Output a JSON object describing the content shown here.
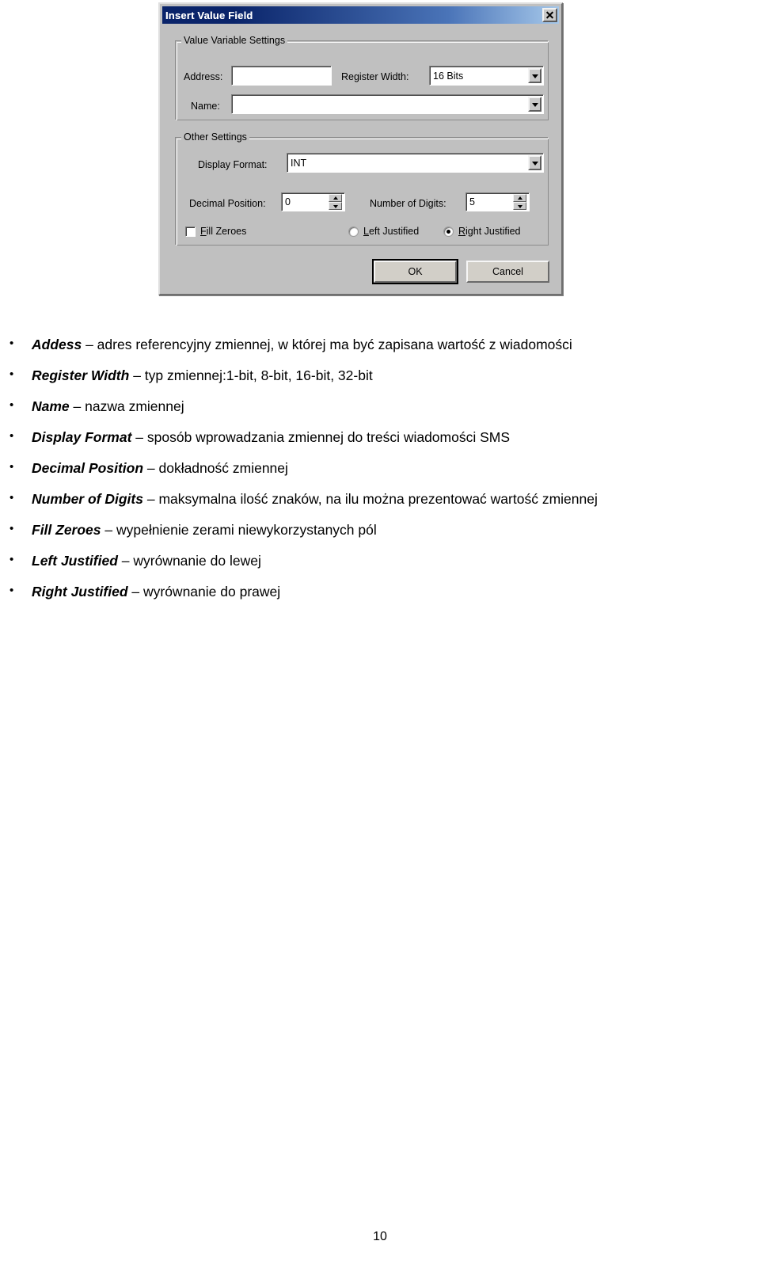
{
  "dialog": {
    "title": "Insert Value Field",
    "close_icon": "close-icon",
    "groups": {
      "value_variable": {
        "legend": "Value Variable Settings",
        "address": {
          "label": "Address:",
          "value": "",
          "placeholder": ""
        },
        "register_width": {
          "label": "Register Width:",
          "value": "16 Bits",
          "options": [
            "1 Bit",
            "8 Bits",
            "16 Bits",
            "32 Bits"
          ]
        },
        "name": {
          "label": "Name:",
          "value": "",
          "placeholder": ""
        }
      },
      "other_settings": {
        "legend": "Other Settings",
        "display_format": {
          "label": "Display Format:",
          "value": "INT",
          "options": [
            "INT"
          ]
        },
        "decimal_position": {
          "label": "Decimal Position:",
          "value": "0"
        },
        "number_of_digits": {
          "label": "Number of Digits:",
          "value": "5"
        },
        "fill_zeroes": {
          "label_pre": "",
          "label_key": "F",
          "label_post": "ill Zeroes",
          "checked": false
        },
        "left_justified": {
          "label_pre": "",
          "label_key": "L",
          "label_post": "eft Justified",
          "checked": false
        },
        "right_justified": {
          "label_pre": "",
          "label_key": "R",
          "label_post": "ight Justified",
          "checked": true
        }
      }
    },
    "buttons": {
      "ok": "OK",
      "cancel": "Cancel"
    }
  },
  "bullets": [
    {
      "term": "Addess",
      "desc": " – adres referencyjny zmiennej, w której ma być zapisana wartość z wiadomości"
    },
    {
      "term": "Register Width",
      "desc": " – typ zmiennej:1-bit, 8-bit, 16-bit, 32-bit"
    },
    {
      "term": "Name",
      "desc": " – nazwa zmiennej"
    },
    {
      "term": "Display Format",
      "desc": " – sposób wprowadzania zmiennej do treści wiadomości SMS"
    },
    {
      "term": "Decimal Position",
      "desc": " – dokładność zmiennej"
    },
    {
      "term": "Number of Digits",
      "desc": " – maksymalna ilość znaków, na ilu można prezentować wartość zmiennej"
    },
    {
      "term": "Fill Zeroes",
      "desc": " – wypełnienie zerami niewykorzystanych pól"
    },
    {
      "term": "Left Justified",
      "desc": " – wyrównanie do lewej"
    },
    {
      "term": "Right Justified",
      "desc": " – wyrównanie do prawej"
    }
  ],
  "page_number": "10"
}
